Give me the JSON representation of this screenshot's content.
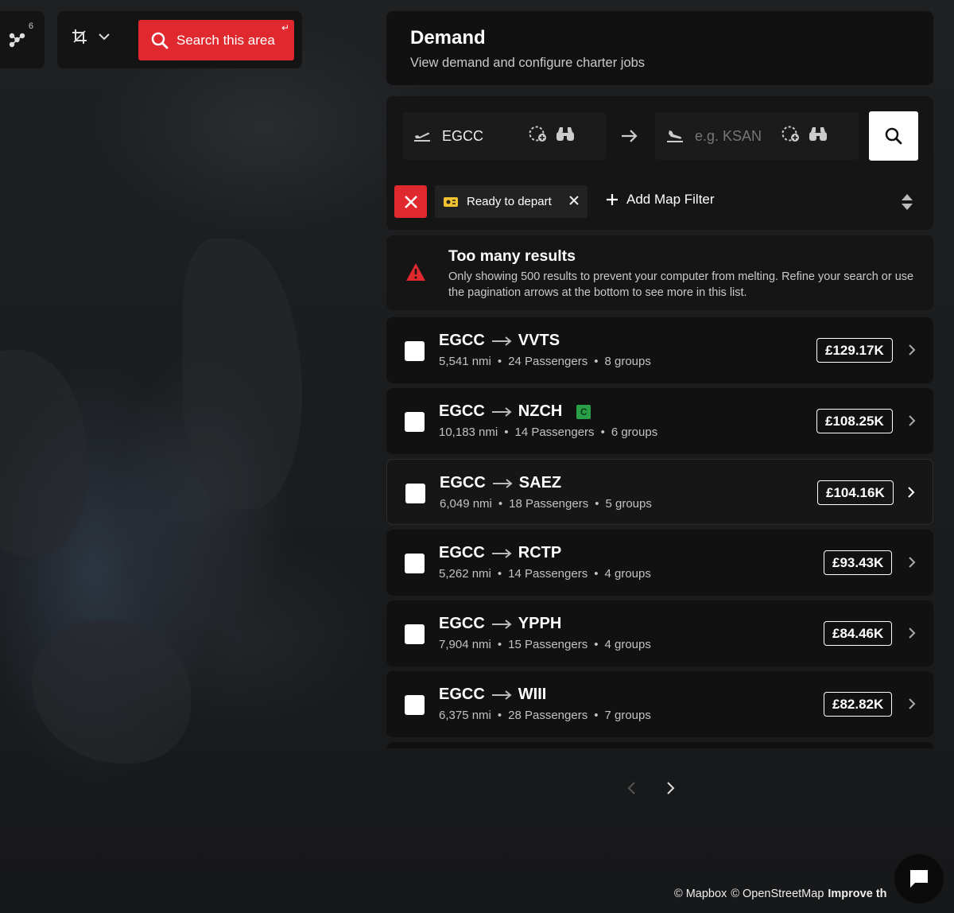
{
  "map": {
    "cluster_count": "6",
    "search_area_label": "Search this area",
    "search_area_hint": "↵",
    "attribution": [
      "© Mapbox",
      "© OpenStreetMap",
      "Improve th"
    ]
  },
  "header": {
    "title": "Demand",
    "subtitle": "View demand and configure charter jobs"
  },
  "search": {
    "origin_value": "EGCC",
    "destination_placeholder": "e.g. KSAN"
  },
  "filters": {
    "active_chip": "Ready to depart",
    "add_label": "Add Map Filter"
  },
  "warning": {
    "title": "Too many results",
    "text": "Only showing 500 results to prevent your computer from melting. Refine your search or use the pagination arrows at the bottom to see more in this list."
  },
  "results": [
    {
      "from": "EGCC",
      "to": "VVTS",
      "distance": "5,541 nmi",
      "passengers": "24 Passengers",
      "groups": "8 groups",
      "price": "£129.17K"
    },
    {
      "from": "EGCC",
      "to": "NZCH",
      "badge": "C",
      "distance": "10,183 nmi",
      "passengers": "14 Passengers",
      "groups": "6 groups",
      "price": "£108.25K"
    },
    {
      "from": "EGCC",
      "to": "SAEZ",
      "distance": "6,049 nmi",
      "passengers": "18 Passengers",
      "groups": "5 groups",
      "price": "£104.16K"
    },
    {
      "from": "EGCC",
      "to": "RCTP",
      "distance": "5,262 nmi",
      "passengers": "14 Passengers",
      "groups": "4 groups",
      "price": "£93.43K"
    },
    {
      "from": "EGCC",
      "to": "YPPH",
      "distance": "7,904 nmi",
      "passengers": "15 Passengers",
      "groups": "4 groups",
      "price": "£84.46K"
    },
    {
      "from": "EGCC",
      "to": "WIII",
      "distance": "6,375 nmi",
      "passengers": "28 Passengers",
      "groups": "7 groups",
      "price": "£82.82K"
    }
  ],
  "colors": {
    "accent": "#e0292f",
    "badge_green": "#29a047",
    "chip_icon_yellow": "#f2c230",
    "panel": "#111111"
  },
  "icons": {
    "cluster": "cluster-icon",
    "crop": "crop-icon",
    "takeoff": "takeoff-icon",
    "landing": "landing-icon",
    "binoculars": "binoculars-icon",
    "radius": "radius-add-icon",
    "warning": "warning-triangle-icon",
    "chat": "chat-icon"
  }
}
